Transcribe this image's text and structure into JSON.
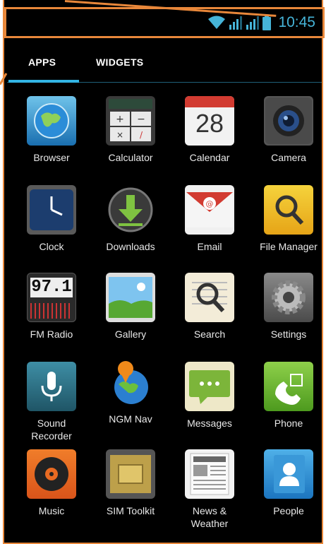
{
  "status": {
    "time": "10:45"
  },
  "tabs": {
    "apps": "APPS",
    "widgets": "WIDGETS"
  },
  "apps": [
    {
      "label": "Browser"
    },
    {
      "label": "Calculator"
    },
    {
      "label": "Calendar",
      "day": "28"
    },
    {
      "label": "Camera"
    },
    {
      "label": "Clock"
    },
    {
      "label": "Downloads"
    },
    {
      "label": "Email"
    },
    {
      "label": "File Manager"
    },
    {
      "label": "FM Radio",
      "freq": "97.1"
    },
    {
      "label": "Gallery"
    },
    {
      "label": "Search"
    },
    {
      "label": "Settings"
    },
    {
      "label": "Sound Recorder"
    },
    {
      "label": "NGM Nav"
    },
    {
      "label": "Messages"
    },
    {
      "label": "Phone"
    },
    {
      "label": "Music"
    },
    {
      "label": "SIM Toolkit"
    },
    {
      "label": "News & Weather"
    },
    {
      "label": "People"
    }
  ],
  "colors": {
    "accent": "#33b5e5",
    "annotation": "#e8873a",
    "clock": "#46b4d8"
  }
}
